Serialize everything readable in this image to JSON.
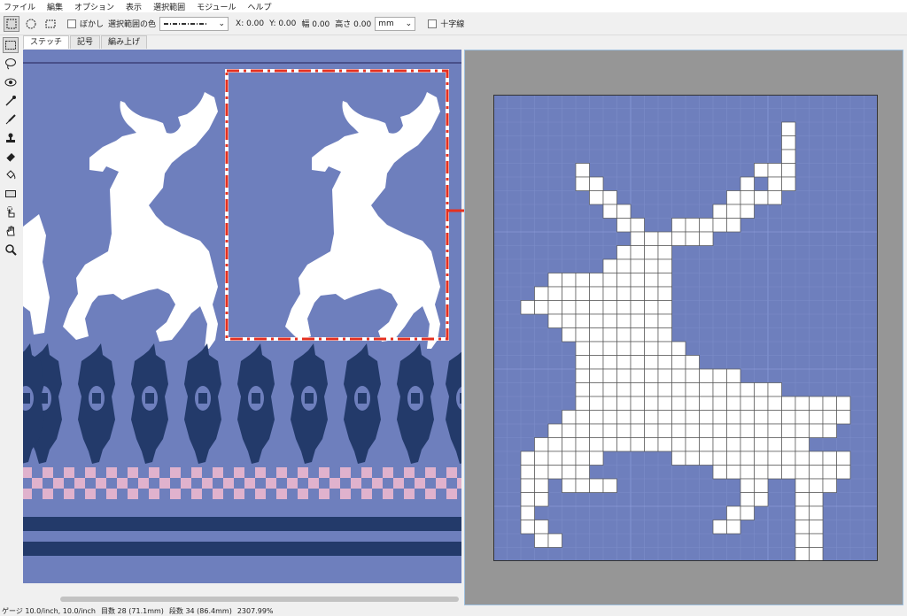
{
  "menu": [
    "ファイル",
    "編集",
    "オプション",
    "表示",
    "選択範囲",
    "モジュール",
    "ヘルプ"
  ],
  "options": {
    "blur_label": "ぼかし",
    "sel_color_label": "選択範囲の色",
    "x": "X: 0.00",
    "y": "Y: 0.00",
    "width": "幅 0.00",
    "height": "高さ 0.00",
    "unit": "mm",
    "crosshair_label": "十字線"
  },
  "tools": [
    "rect-select",
    "lasso",
    "magic-wand",
    "eyedropper",
    "brush",
    "stamp",
    "eraser",
    "fill-bucket",
    "rectangle",
    "hand-pointer",
    "hand",
    "zoom"
  ],
  "tabs": [
    "ステッチ",
    "記号",
    "編み上げ"
  ],
  "status": {
    "gauge": "ゲージ 10.0/inch, 10.0/inch",
    "stitches": "目数 28 (71.1mm)",
    "rows": "段数 34 (86.4mm)",
    "zoom": "2307.99%"
  },
  "colors": {
    "background": "#6e7fbd",
    "navy": "#233a6a",
    "pink": "#e0b2cd",
    "white": "#ffffff",
    "selection": "#e53020",
    "arrow": "#e53020",
    "panel": "#969696"
  },
  "grid": {
    "cols": 28,
    "rows": 34,
    "rle": [
      [],
      [],
      [
        [
          21,
          1
        ]
      ],
      [
        [
          21,
          1
        ]
      ],
      [
        [
          21,
          1
        ]
      ],
      [
        [
          6,
          1
        ],
        [
          19,
          3
        ]
      ],
      [
        [
          6,
          2
        ],
        [
          18,
          1
        ],
        [
          20,
          2
        ]
      ],
      [
        [
          7,
          2
        ],
        [
          17,
          4
        ]
      ],
      [
        [
          8,
          2
        ],
        [
          16,
          3
        ]
      ],
      [
        [
          9,
          2
        ],
        [
          13,
          5
        ]
      ],
      [
        [
          10,
          6
        ]
      ],
      [
        [
          9,
          4
        ]
      ],
      [
        [
          8,
          5
        ]
      ],
      [
        [
          4,
          9
        ]
      ],
      [
        [
          3,
          10
        ]
      ],
      [
        [
          2,
          11
        ]
      ],
      [
        [
          4,
          9
        ]
      ],
      [
        [
          5,
          8
        ]
      ],
      [
        [
          6,
          8
        ]
      ],
      [
        [
          6,
          9
        ]
      ],
      [
        [
          6,
          12
        ]
      ],
      [
        [
          6,
          15
        ]
      ],
      [
        [
          6,
          20
        ]
      ],
      [
        [
          5,
          21
        ]
      ],
      [
        [
          4,
          21
        ]
      ],
      [
        [
          3,
          20
        ]
      ],
      [
        [
          2,
          6
        ],
        [
          13,
          13
        ]
      ],
      [
        [
          2,
          5
        ],
        [
          16,
          10
        ]
      ],
      [
        [
          2,
          2
        ],
        [
          5,
          4
        ],
        [
          18,
          2
        ],
        [
          22,
          3
        ]
      ],
      [
        [
          2,
          2
        ],
        [
          18,
          2
        ],
        [
          22,
          2
        ]
      ],
      [
        [
          2,
          1
        ],
        [
          17,
          2
        ],
        [
          22,
          2
        ]
      ],
      [
        [
          2,
          2
        ],
        [
          16,
          2
        ],
        [
          22,
          2
        ]
      ],
      [
        [
          3,
          2
        ],
        [
          22,
          2
        ]
      ],
      [
        [
          22,
          2
        ]
      ]
    ]
  }
}
